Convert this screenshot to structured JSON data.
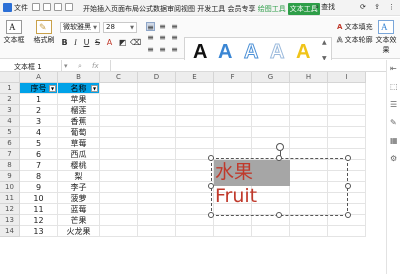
{
  "menubar": {
    "file_label": "文件",
    "tabs": [
      "开始",
      "插入",
      "页面布局",
      "公式",
      "数据",
      "审阅",
      "视图",
      "开发工具",
      "会员专享"
    ],
    "drawing_tools": "绘图工具",
    "textbox_tools": "文本工具",
    "search": "查找"
  },
  "toolbar": {
    "textbox_btn": "文本框",
    "format_painter": "格式刷",
    "font_name": "微软雅黑",
    "font_size": "28",
    "bold": "B",
    "italic": "I",
    "underline": "U",
    "strike": "S",
    "text_fill": "文本填充",
    "text_outline": "文本轮廓",
    "text_effect": "文本效果",
    "wordart_letter": "A",
    "wordart_colors": [
      "#111111",
      "#3a86d4",
      "#7fb2e5",
      "#b6cde6",
      "#f0c419"
    ]
  },
  "formula_bar": {
    "name_box": "文本框 1",
    "fx": "fx"
  },
  "grid": {
    "columns": [
      "A",
      "B",
      "C",
      "D",
      "E",
      "F",
      "G",
      "H",
      "I"
    ],
    "rows": [
      "1",
      "2",
      "3",
      "4",
      "5",
      "6",
      "7",
      "8",
      "9",
      "10",
      "11",
      "12",
      "13",
      "14"
    ],
    "header": [
      "序号",
      "名称"
    ],
    "data": [
      [
        "1",
        "苹果"
      ],
      [
        "2",
        "榴莲"
      ],
      [
        "3",
        "香蕉"
      ],
      [
        "4",
        "葡萄"
      ],
      [
        "5",
        "草莓"
      ],
      [
        "6",
        "西瓜"
      ],
      [
        "7",
        "樱桃"
      ],
      [
        "8",
        "梨"
      ],
      [
        "9",
        "李子"
      ],
      [
        "10",
        "菠萝"
      ],
      [
        "11",
        "蓝莓"
      ],
      [
        "12",
        "芒果"
      ],
      [
        "13",
        "火龙果"
      ]
    ]
  },
  "textbox": {
    "content": "水果Fruit",
    "fill_color": "#a6a6a6",
    "text_color": "#c0392b"
  }
}
